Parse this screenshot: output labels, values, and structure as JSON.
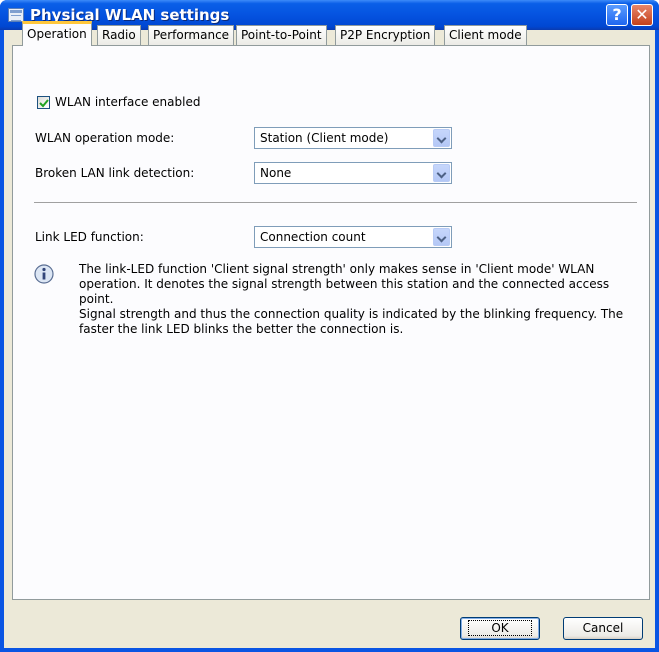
{
  "window": {
    "title": "Physical WLAN settings"
  },
  "tabs": [
    {
      "label": "Operation",
      "active": true
    },
    {
      "label": "Radio"
    },
    {
      "label": "Performance"
    },
    {
      "label": "Point-to-Point"
    },
    {
      "label": "P2P Encryption"
    },
    {
      "label": "Client mode"
    }
  ],
  "operation": {
    "wlan_enabled": {
      "label": "WLAN interface enabled",
      "checked": true
    },
    "operation_mode": {
      "label": "WLAN operation mode:",
      "value": "Station (Client mode)"
    },
    "broken_lan": {
      "label": "Broken LAN link detection:",
      "value": "None"
    },
    "link_led": {
      "label": "Link LED function:",
      "value": "Connection count"
    },
    "info": {
      "line1": "The link-LED function 'Client signal strength' only makes sense in 'Client mode' WLAN operation. It denotes the signal strength between this station and the connected access point.",
      "line2": "Signal strength and thus the connection quality is indicated by the blinking frequency. The faster the link LED blinks the better the connection is."
    }
  },
  "buttons": {
    "ok": "OK",
    "cancel": "Cancel"
  },
  "icons": {
    "window": "window-app-icon",
    "help": "help-icon",
    "close": "close-icon",
    "info": "info-icon",
    "check": "checkmark-icon",
    "dropdown": "chevron-down-icon"
  }
}
